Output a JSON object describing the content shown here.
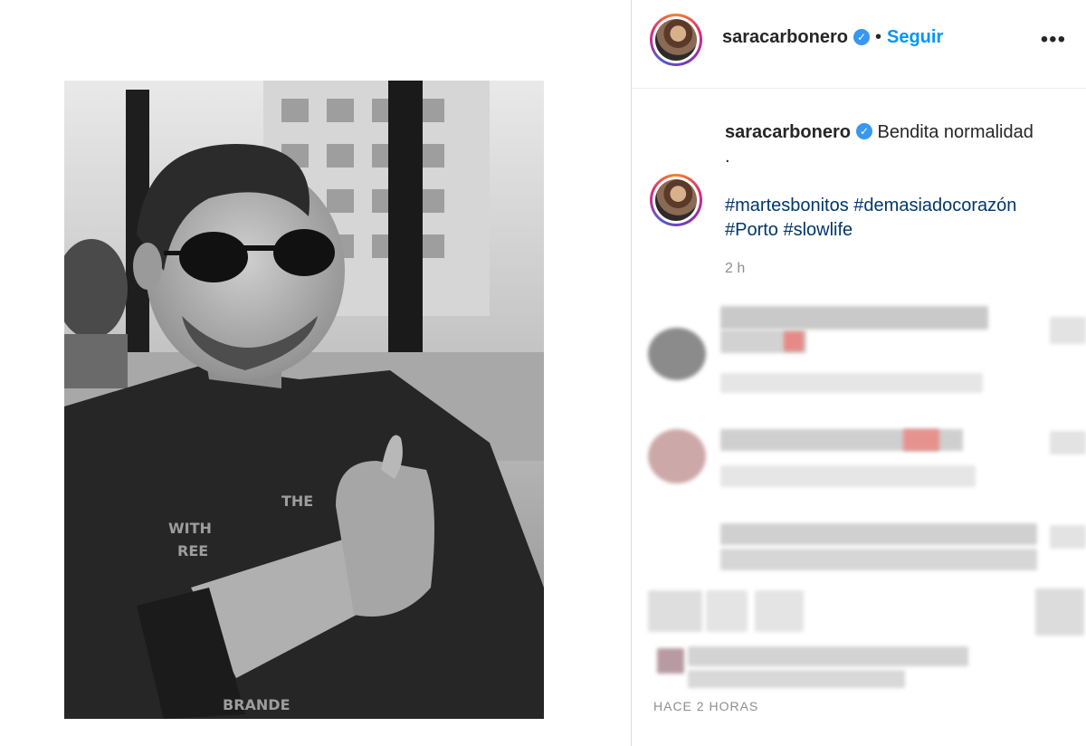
{
  "post": {
    "username": "saracarbonero",
    "follow_label": "Seguir",
    "dot": "•",
    "verified_glyph": "✓",
    "more_glyph": "•••"
  },
  "caption": {
    "username": "saracarbonero",
    "text": "Bendita normalidad",
    "line2": ".",
    "hashtags_line1": "#martesbonitos #demasiadocorazón",
    "hashtags_line2": "#Porto #slowlife",
    "time_ago": "2 h"
  },
  "footer": {
    "timestamp": "HACE 2 HORAS"
  },
  "icons": {
    "verified": "verified-badge-icon",
    "more": "more-options-icon"
  },
  "colors": {
    "follow_blue": "#0095f6",
    "hashtag_blue": "#00376b",
    "verified_blue": "#3897f0",
    "muted_gray": "#8e8e8e"
  }
}
